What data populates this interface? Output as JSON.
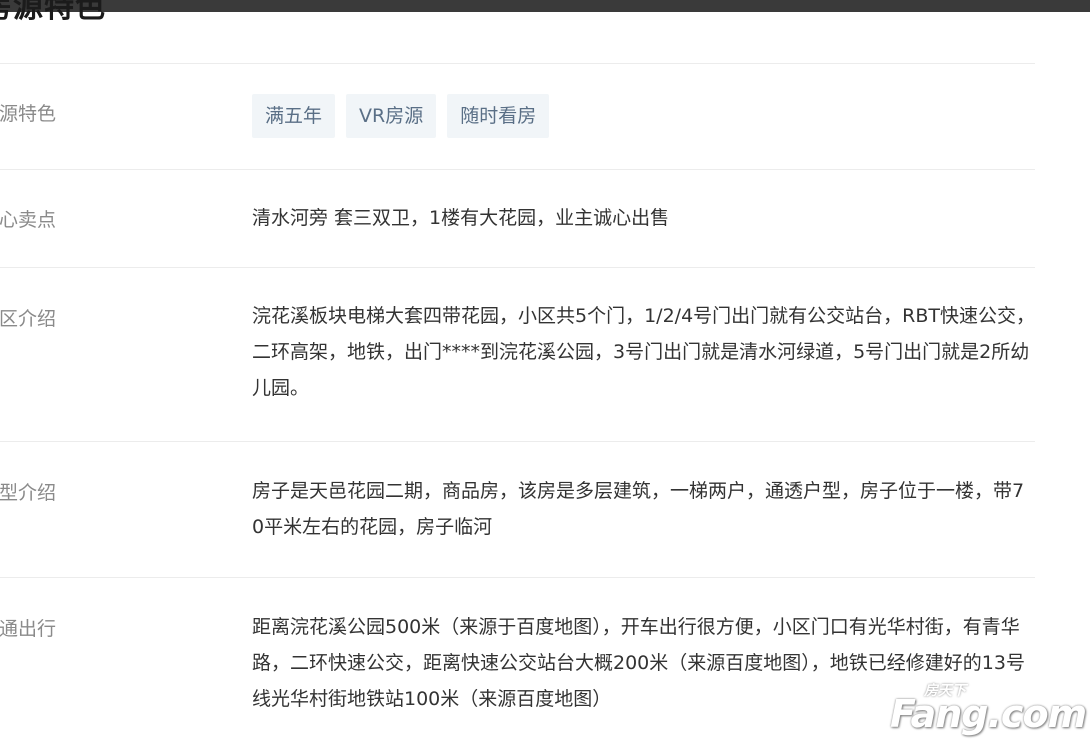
{
  "section": {
    "title": "房源特色"
  },
  "rows": [
    {
      "label": "房源特色",
      "type": "tags"
    },
    {
      "label": "核心卖点",
      "value": "清水河旁 套三双卫，1楼有大花园，业主诚心出售"
    },
    {
      "label": "小区介绍",
      "value": "浣花溪板块电梯大套四带花园，小区共5个门，1/2/4号门出门就有公交站台，RBT快速公交，二环高架，地铁，出门****到浣花溪公园，3号门出门就是清水河绿道，5号门出门就是2所幼儿园。"
    },
    {
      "label": "户型介绍",
      "value": "房子是天邑花园二期，商品房，该房是多层建筑，一梯两户，通透户型，房子位于一楼，带70平米左右的花园，房子临河"
    },
    {
      "label": "交通出行",
      "value": "距离浣花溪公园500米（来源于百度地图），开车出行很方便，小区门口有光华村街，有青华路，二环快速公交，距离快速公交站台大概200米（来源百度地图），地铁已经修建好的13号线光华村街地铁站100米（来源百度地图）"
    }
  ],
  "tags": [
    "满五年",
    "VR房源",
    "随时看房"
  ],
  "watermark": {
    "main": "Fang.com",
    "cn": "房天下"
  },
  "colors": {
    "tag_bg": "#f1f5f8",
    "tag_text": "#5a6f86",
    "label": "#8a8a8a",
    "divider": "#ececec"
  }
}
